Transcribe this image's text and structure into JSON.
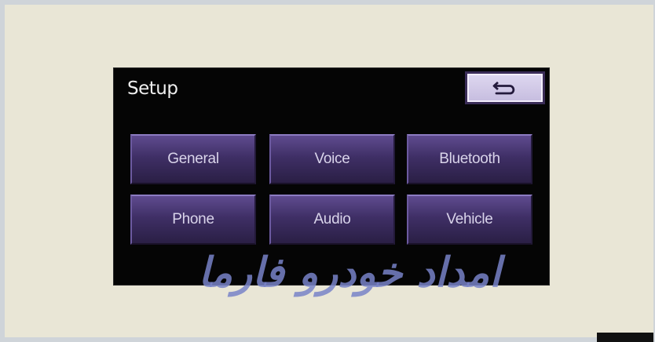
{
  "header": {
    "title": "Setup"
  },
  "buttons": {
    "back_icon": "back-arrow-icon",
    "menu": [
      {
        "label": "General"
      },
      {
        "label": "Voice"
      },
      {
        "label": "Bluetooth"
      },
      {
        "label": "Phone"
      },
      {
        "label": "Audio"
      },
      {
        "label": "Vehicle"
      }
    ]
  },
  "watermark": {
    "text": "امداد خودرو فارما"
  },
  "colors": {
    "screen_bg": "#050505",
    "page_bg": "#e9e6d6",
    "menu_button": "#3f2f66",
    "back_button": "#ddd6ef"
  }
}
